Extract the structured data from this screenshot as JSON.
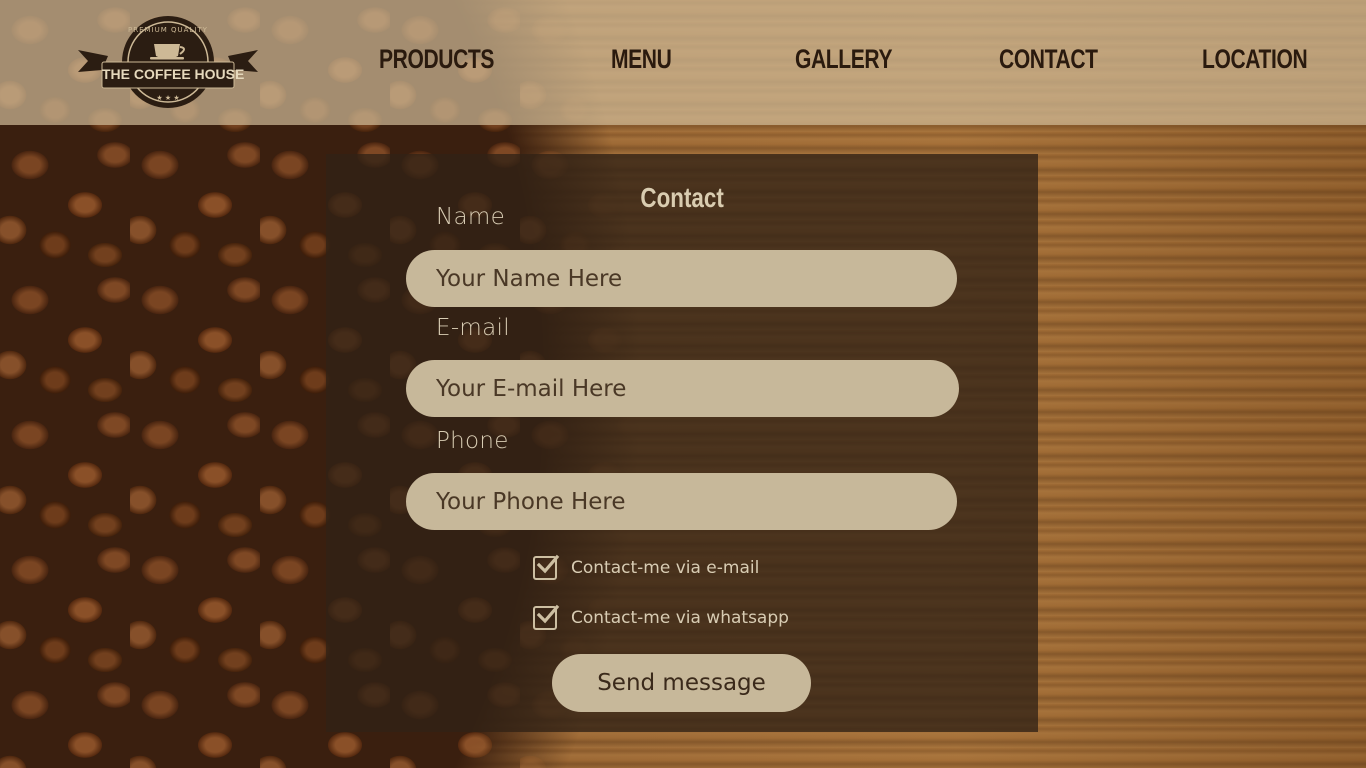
{
  "brand": {
    "logo_top_text": "PREMIUM QUALITY",
    "logo_name": "THE COFFEE HOUSE"
  },
  "nav": {
    "items": [
      {
        "label": "PRODUCTS"
      },
      {
        "label": "MENU"
      },
      {
        "label": "GALLERY"
      },
      {
        "label": "CONTACT"
      },
      {
        "label": "LOCATION"
      }
    ]
  },
  "contact_form": {
    "title": "Contact",
    "fields": [
      {
        "label": "Name",
        "placeholder": "Your Name Here"
      },
      {
        "label": "E-mail",
        "placeholder": "Your E-mail Here"
      },
      {
        "label": "Phone",
        "placeholder": "Your Phone Here"
      }
    ],
    "options": [
      {
        "label": "Contact-me via e-mail",
        "checked": true
      },
      {
        "label": "Contact-me via whatsapp",
        "checked": true
      }
    ],
    "submit_label": "Send message"
  },
  "colors": {
    "header_bg": "#cdb996",
    "panel_bg": "#322216",
    "input_bg": "#c7b89a",
    "text_light": "#d8ccb3",
    "text_dark": "#2a1a0e"
  },
  "icons": {
    "checkbox": "checkmark-icon",
    "logo": "coffee-cup-icon"
  }
}
